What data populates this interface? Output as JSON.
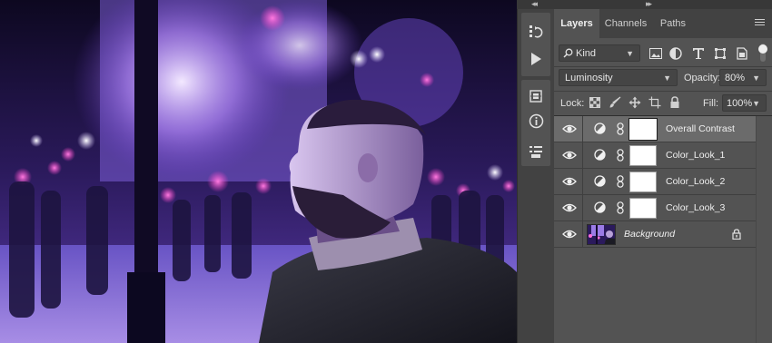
{
  "panel": {
    "tabs": [
      {
        "label": "Layers",
        "active": true
      },
      {
        "label": "Channels",
        "active": false
      },
      {
        "label": "Paths",
        "active": false
      }
    ],
    "filter": {
      "value": "Kind"
    },
    "blend_mode": {
      "value": "Luminosity"
    },
    "opacity": {
      "label": "Opacity:",
      "value": "80%"
    },
    "lock": {
      "label": "Lock:"
    },
    "fill": {
      "label": "Fill:",
      "value": "100%"
    },
    "layers": [
      {
        "name": "Overall Contrast",
        "type": "adjustment",
        "selected": true
      },
      {
        "name": "Color_Look_1",
        "type": "adjustment",
        "selected": false
      },
      {
        "name": "Color_Look_2",
        "type": "adjustment",
        "selected": false
      },
      {
        "name": "Color_Look_3",
        "type": "adjustment",
        "selected": false
      },
      {
        "name": "Background",
        "type": "image",
        "selected": false,
        "locked": true
      }
    ]
  },
  "strip": {
    "icons": [
      "history-icon",
      "play-actions-icon",
      "libraries-icon",
      "info-icon",
      "properties-icon"
    ]
  },
  "colors": {
    "panel_bg": "#535353",
    "panel_dark": "#424242",
    "selected_row": "#6b6b6b",
    "text": "#e6e6e6"
  }
}
